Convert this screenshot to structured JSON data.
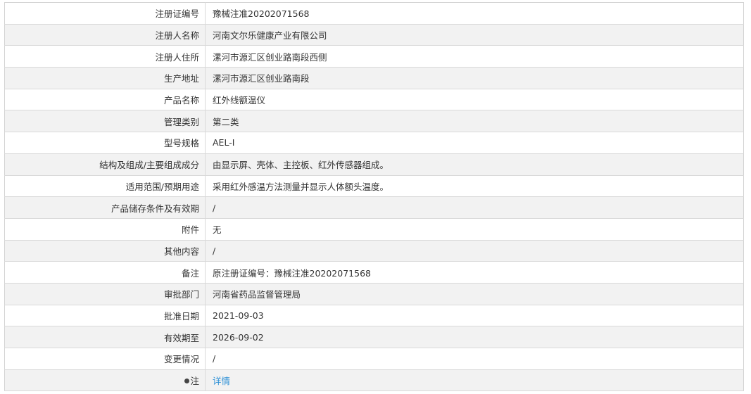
{
  "rows": [
    {
      "label": "注册证编号",
      "value": "豫械注准20202071568"
    },
    {
      "label": "注册人名称",
      "value": "河南文尔乐健康产业有限公司"
    },
    {
      "label": "注册人住所",
      "value": "漯河市源汇区创业路南段西侧"
    },
    {
      "label": "生产地址",
      "value": "漯河市源汇区创业路南段"
    },
    {
      "label": "产品名称",
      "value": "红外线额温仪"
    },
    {
      "label": "管理类别",
      "value": "第二类"
    },
    {
      "label": "型号规格",
      "value": "AEL-I"
    },
    {
      "label": "结构及组成/主要组成成分",
      "value": "由显示屏、壳体、主控板、红外传感器组成。"
    },
    {
      "label": "适用范围/预期用途",
      "value": "采用红外感温方法测量并显示人体额头温度。"
    },
    {
      "label": "产品储存条件及有效期",
      "value": "/"
    },
    {
      "label": "附件",
      "value": "无"
    },
    {
      "label": "其他内容",
      "value": "/"
    },
    {
      "label": "备注",
      "value": "原注册证编号：豫械注准20202071568"
    },
    {
      "label": "审批部门",
      "value": "河南省药品监督管理局"
    },
    {
      "label": "批准日期",
      "value": "2021-09-03"
    },
    {
      "label": "有效期至",
      "value": "2026-09-02"
    },
    {
      "label": "变更情况",
      "value": "/"
    }
  ],
  "note_row": {
    "label": "注",
    "icon": "pin-icon",
    "link_text": "详情"
  }
}
